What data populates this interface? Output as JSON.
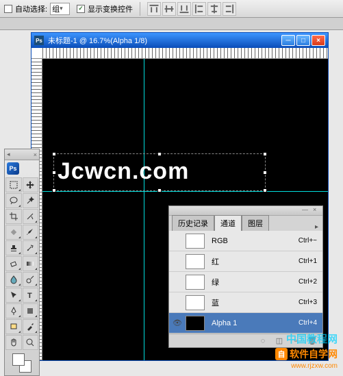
{
  "options": {
    "auto_select_label": "自动选择:",
    "group": "组",
    "show_transform_label": "显示变换控件"
  },
  "doc": {
    "title": "未标题-1 @ 16.7%(Alpha 1/8)",
    "text": "Jcwcn.com"
  },
  "channels": {
    "tabs": {
      "history": "历史记录",
      "channels": "通道",
      "layers": "图层"
    },
    "rows": [
      {
        "name": "RGB",
        "shortcut": "Ctrl+~",
        "swatch": "#ffffff",
        "eye": false
      },
      {
        "name": "红",
        "shortcut": "Ctrl+1",
        "swatch": "#ffffff",
        "eye": false
      },
      {
        "name": "绿",
        "shortcut": "Ctrl+2",
        "swatch": "#ffffff",
        "eye": false
      },
      {
        "name": "蓝",
        "shortcut": "Ctrl+3",
        "swatch": "#ffffff",
        "eye": false
      },
      {
        "name": "Alpha 1",
        "shortcut": "Ctrl+4",
        "swatch": "#000000",
        "eye": true,
        "selected": true
      }
    ]
  },
  "watermark": {
    "line1": "中国教程网",
    "badge": "自",
    "brand": "软件自学网",
    "url": "www.rjzxw.com"
  }
}
